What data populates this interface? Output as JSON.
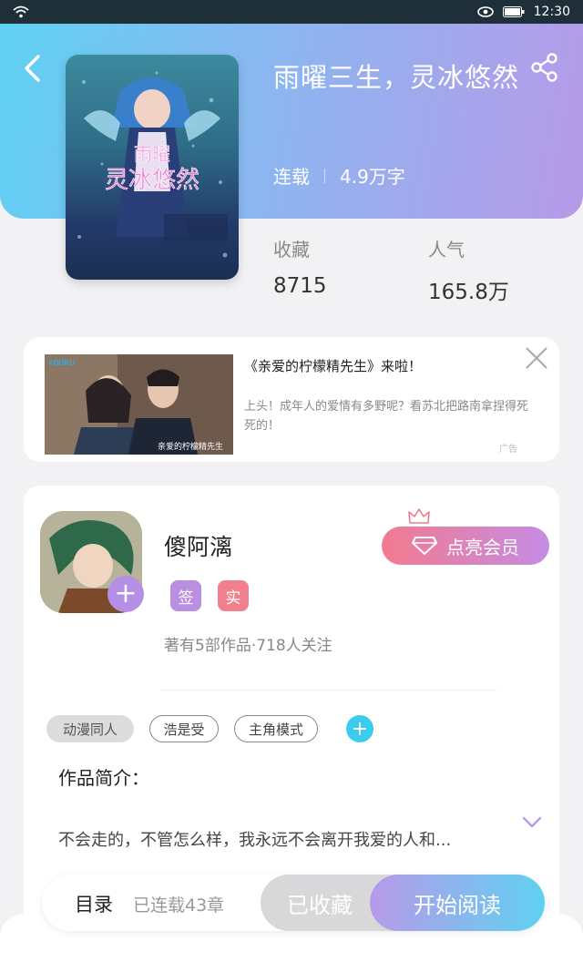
{
  "status_bar": {
    "time": "12:30",
    "icons": [
      "wifi-icon",
      "eye-icon",
      "battery-icon"
    ]
  },
  "book": {
    "title": "雨曜三生，灵冰悠然",
    "status": "连载",
    "word_count": "4.9万字",
    "stats": [
      {
        "label": "收藏",
        "value": "8715"
      },
      {
        "label": "人气",
        "value": "165.8万"
      }
    ],
    "cover_text": [
      "雨曜",
      "灵冰悠然"
    ]
  },
  "ad": {
    "title": "《亲爱的柠檬精先生》来啦！",
    "description": "上头！成年人的爱情有多野呢？看苏北把路南拿捏得死死的！",
    "badge": "广告",
    "image_brand": "YOUKU",
    "image_caption": "亲爱的柠檬精先生"
  },
  "author": {
    "name": "傻阿漓",
    "vip_label": "点亮会员",
    "badges": [
      {
        "label": "签",
        "color": "#b98ee3"
      },
      {
        "label": "实",
        "color": "#f27f8c"
      }
    ],
    "stats_text": "著有5部作品·718人关注"
  },
  "tags": [
    "动漫同人",
    "浩是受",
    "主角模式"
  ],
  "intro": {
    "heading": "作品简介：",
    "text": "不会走的，不管怎么样，我永远不会离开我爱的人和..."
  },
  "bottom_bar": {
    "toc_label": "目录",
    "toc_count": "已连载43章",
    "collected_label": "已收藏",
    "read_label": "开始阅读"
  },
  "colors": {
    "header_gradient": [
      "#5fd1f2",
      "#b79ae8"
    ],
    "vip_gradient": [
      "#f27a8e",
      "#c58ce4"
    ],
    "accent_cyan": "#3ccbee"
  }
}
